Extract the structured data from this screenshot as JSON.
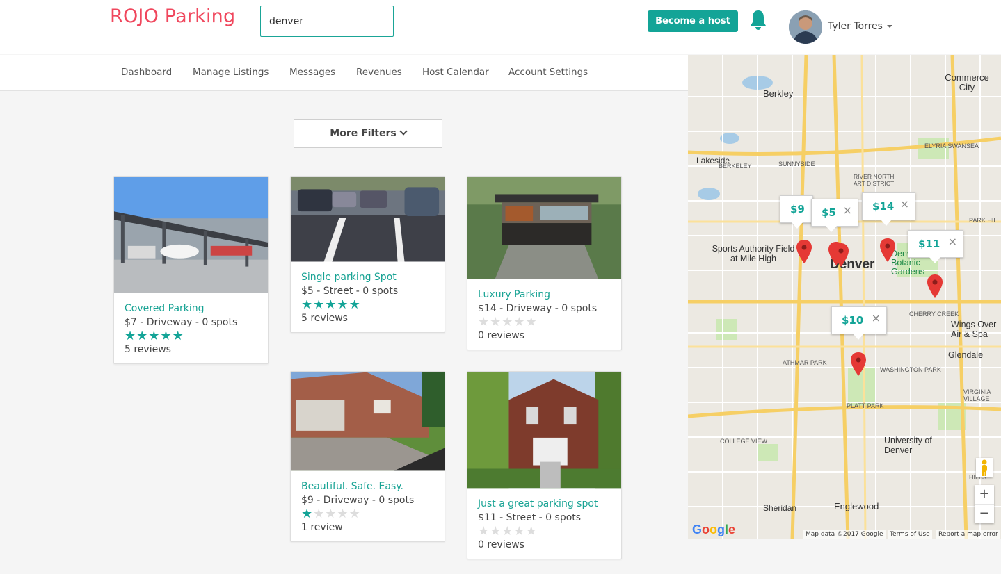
{
  "header": {
    "brand": "ROJO Parking",
    "search_value": "denver",
    "host_button": "Become a host",
    "user_name": "Tyler Torres"
  },
  "nav": {
    "items": [
      "Dashboard",
      "Manage Listings",
      "Messages",
      "Revenues",
      "Host Calendar",
      "Account Settings"
    ]
  },
  "filters": {
    "label": "More Filters"
  },
  "listings": [
    {
      "title": "Covered Parking",
      "meta": "$7 - Driveway - 0 spots",
      "rating": 5,
      "reviews": "5 reviews"
    },
    {
      "title": "Single parking Spot",
      "meta": "$5 - Street - 0 spots",
      "rating": 5,
      "reviews": "5 reviews"
    },
    {
      "title": "Luxury Parking",
      "meta": "$14 - Driveway - 0 spots",
      "rating": 0,
      "reviews": "0 reviews"
    },
    {
      "title": "Beautiful. Safe. Easy.",
      "meta": "$9 - Driveway - 0 spots",
      "rating": 1,
      "reviews": "1 review"
    },
    {
      "title": "Just a great parking spot",
      "meta": "$11 - Street - 0 spots",
      "rating": 0,
      "reviews": "0 reviews"
    }
  ],
  "map": {
    "callouts": [
      "$9",
      "$5",
      "$14",
      "$11",
      "$10"
    ],
    "close_glyph": "×",
    "labels": {
      "denver": "Denver",
      "berkley": "Berkley",
      "commerce_city": "Commerce City",
      "lakeside": "Lakeside",
      "sports_authority": "Sports Authority Field at Mile High",
      "botanic": "Denver Botanic Gardens",
      "wings": "Wings Over Air & Spa",
      "glendale": "Glendale",
      "university": "University of Denver",
      "englewood": "Englewood",
      "sheridan": "Sheridan",
      "platt_park": "PLATT PARK",
      "washington_park": "WASHINGTON PARK",
      "athmar_park": "ATHMAR PARK",
      "college_view": "COLLEGE VIEW",
      "cherry_creek": "CHERRY CREEK",
      "sunnyside": "SUNNYSIDE",
      "berkeley": "BERKELEY",
      "elyria": "ELYRIA SWANSEA",
      "rino": "RIVER NORTH ART DISTRICT",
      "park_hill": "PARK HILL",
      "virginia_village": "VIRGINIA VILLAGE",
      "hills": "HILLS"
    },
    "zoom_in": "+",
    "zoom_out": "−",
    "google": "Google",
    "map_data": "Map data ©2017 Google",
    "terms": "Terms of Use",
    "report": "Report a map error"
  },
  "colors": {
    "brand": "#f0475d",
    "accent": "#13a497",
    "pin": "#e53935"
  }
}
